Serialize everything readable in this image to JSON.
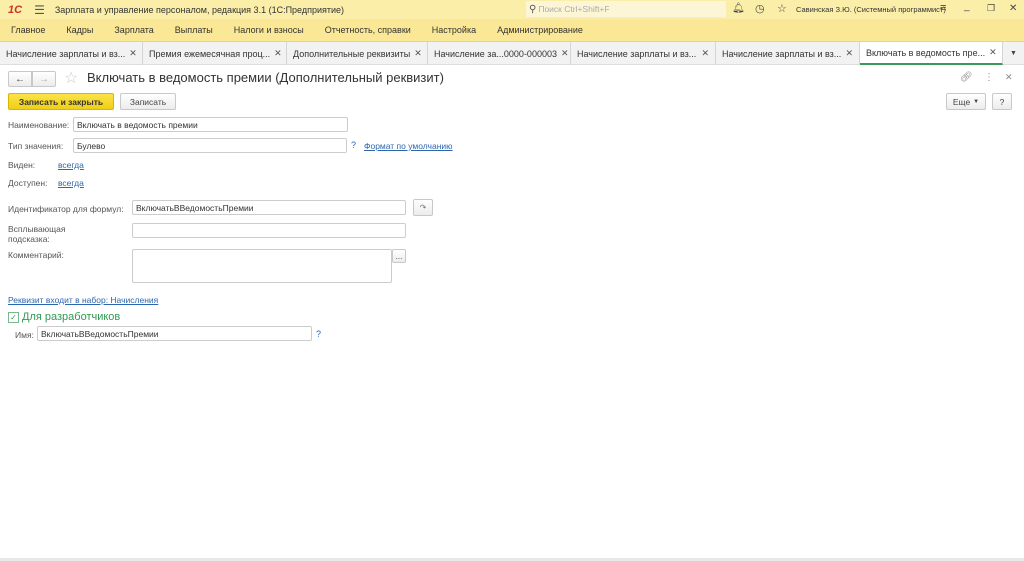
{
  "app": {
    "title": "Зарплата и управление персоналом, редакция 3.1  (1С:Предприятие)",
    "search_placeholder": "Поиск Ctrl+Shift+F",
    "user": "Савинская З.Ю. (Системный программист)",
    "logo": "1С"
  },
  "menu": [
    "Главное",
    "Кадры",
    "Зарплата",
    "Выплаты",
    "Налоги и взносы",
    "Отчетность, справки",
    "Настройка",
    "Администрирование"
  ],
  "tabs": [
    {
      "label": "Начисление зарплаты и вз..."
    },
    {
      "label": "Премия ежемесячная проц..."
    },
    {
      "label": "Дополнительные реквизиты"
    },
    {
      "label": "Начисление за...0000-000003"
    },
    {
      "label": "Начисление зарплаты и вз..."
    },
    {
      "label": "Начисление зарплаты и вз..."
    },
    {
      "label": "Включать в ведомость пре...",
      "active": true
    }
  ],
  "form": {
    "title": "Включать в ведомость премии (Дополнительный реквизит)",
    "save_close": "Записать и закрыть",
    "save": "Записать",
    "more": "Еще",
    "help": "?",
    "name_label": "Наименование:",
    "name_value": "Включать в ведомость премии",
    "type_label": "Тип значения:",
    "type_value": "Булево",
    "type_help": "?",
    "format_link": "Формат по умолчанию",
    "visible_label": "Виден:",
    "visible_value": "всегда",
    "available_label": "Доступен:",
    "available_value": "всегда",
    "id_label": "Идентификатор для формул:",
    "id_value": "ВключатьВВедомостьПремии",
    "tooltip_label": "Всплывающая подсказка:",
    "tooltip_value": "",
    "comment_label": "Комментарий:",
    "comment_value": "",
    "comment_btn": "...",
    "set_link": "Реквизит входит в набор: Начисления",
    "dev_group": "Для разработчиков",
    "dev_name_label": "Имя:",
    "dev_name_value": "ВключатьВВедомостьПремии",
    "dev_help": "?"
  }
}
